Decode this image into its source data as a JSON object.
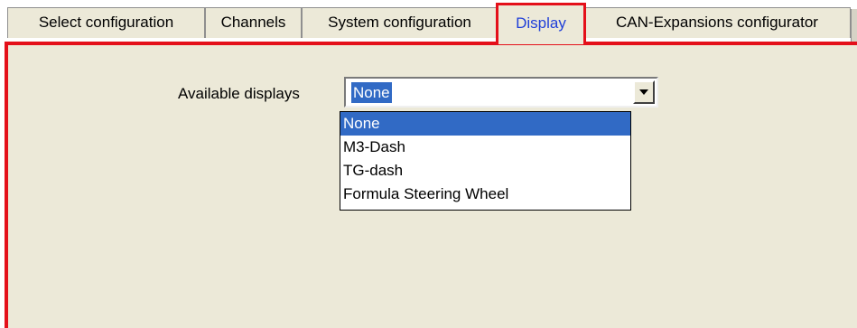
{
  "tabs": [
    {
      "label": "Select configuration"
    },
    {
      "label": "Channels"
    },
    {
      "label": "System configuration"
    },
    {
      "label": "Display"
    },
    {
      "label": "CAN-Expansions configurator"
    }
  ],
  "display": {
    "field_label": "Available displays",
    "selected_value": "None",
    "options": [
      {
        "label": "None"
      },
      {
        "label": "M3-Dash"
      },
      {
        "label": "TG-dash"
      },
      {
        "label": "Formula Steering Wheel"
      }
    ]
  },
  "colors": {
    "highlight_border": "#e4101a",
    "active_tab_text": "#1f3fd8",
    "selection": "#316ac5",
    "panel": "#ece9d8"
  },
  "icons": {
    "dropdown": "chevron-down-icon"
  }
}
